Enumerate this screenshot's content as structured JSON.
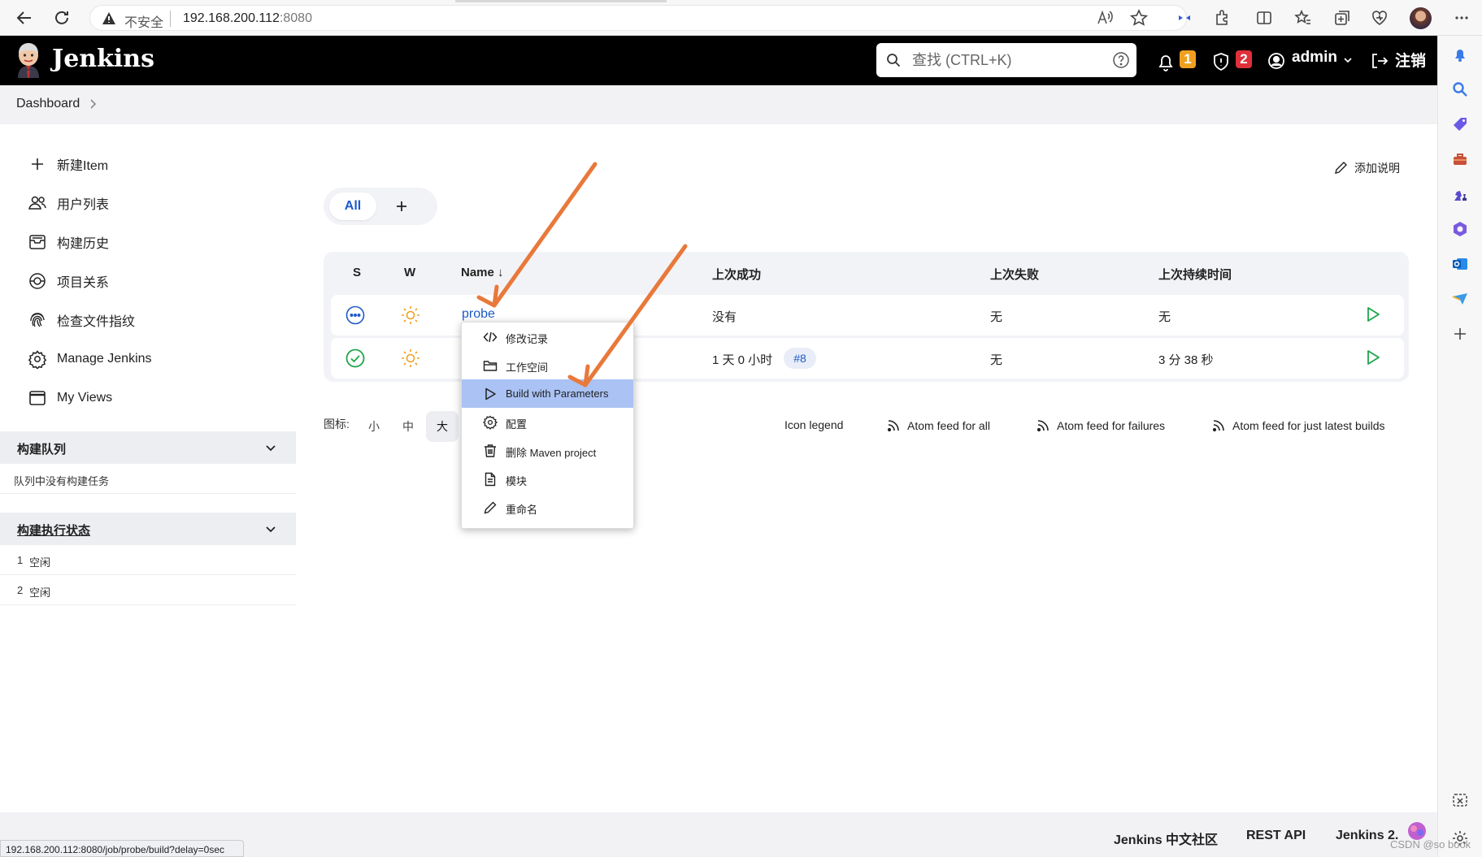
{
  "browser": {
    "insecure_label": "不安全",
    "url_host": "192.168.200.112",
    "url_port": ":8080",
    "status_url": "192.168.200.112:8080/job/probe/build?delay=0sec"
  },
  "header": {
    "brand": "Jenkins",
    "search_placeholder": "查找 (CTRL+K)",
    "notifications_count": "1",
    "security_count": "2",
    "user": "admin",
    "logout": "注销",
    "notifications_color": "#f0a020",
    "security_color": "#e0303a"
  },
  "breadcrumb": {
    "item": "Dashboard"
  },
  "sidebar": {
    "items": [
      {
        "label": "新建Item",
        "icon": "plus-icon"
      },
      {
        "label": "用户列表",
        "icon": "users-icon"
      },
      {
        "label": "构建历史",
        "icon": "history-icon"
      },
      {
        "label": "项目关系",
        "icon": "relationship-icon"
      },
      {
        "label": "检查文件指纹",
        "icon": "fingerprint-icon"
      },
      {
        "label": "Manage Jenkins",
        "icon": "gear-icon"
      },
      {
        "label": "My Views",
        "icon": "window-icon"
      }
    ],
    "queue": {
      "title": "构建队列",
      "empty": "队列中没有构建任务"
    },
    "executors": {
      "title": "构建执行状态",
      "rows": [
        {
          "num": "1",
          "state": "空闲"
        },
        {
          "num": "2",
          "state": "空闲"
        }
      ]
    }
  },
  "main": {
    "add_description": "添加说明",
    "tabs": {
      "all": "All"
    },
    "columns": {
      "s": "S",
      "w": "W",
      "name": "Name",
      "sort": "↓",
      "last_success": "上次成功",
      "last_failure": "上次失败",
      "last_duration": "上次持续时间"
    },
    "rows": [
      {
        "name": "probe",
        "last_success": "没有",
        "last_failure": "无",
        "last_duration": "无"
      },
      {
        "last_success": "1 天 0 小时",
        "build": "#8",
        "last_failure": "无",
        "last_duration": "3 分 38 秒"
      }
    ],
    "icon_size": {
      "label": "图标:",
      "small": "小",
      "medium": "中",
      "large": "大"
    },
    "feeds": {
      "legend": "Icon legend",
      "all": "Atom feed for all",
      "failures": "Atom feed for failures",
      "latest": "Atom feed for just latest builds"
    }
  },
  "context_menu": {
    "items": [
      {
        "label": "修改记录",
        "icon": "code-icon"
      },
      {
        "label": "工作空间",
        "icon": "folder-icon"
      },
      {
        "label": "Build with Parameters",
        "icon": "play-icon"
      },
      {
        "label": "配置",
        "icon": "gear-icon"
      },
      {
        "label": "删除 Maven project",
        "icon": "trash-icon"
      },
      {
        "label": "模块",
        "icon": "document-icon"
      },
      {
        "label": "重命名",
        "icon": "pencil-icon"
      }
    ]
  },
  "footer": {
    "community": "Jenkins 中文社区",
    "rest_api": "REST API",
    "version": "Jenkins 2."
  },
  "watermark": "CSDN @so book",
  "colors": {
    "accent": "#1e5ac8",
    "success": "#1ea64b",
    "arrow": "#e8793a",
    "menu_highlight": "#aac2f4"
  }
}
